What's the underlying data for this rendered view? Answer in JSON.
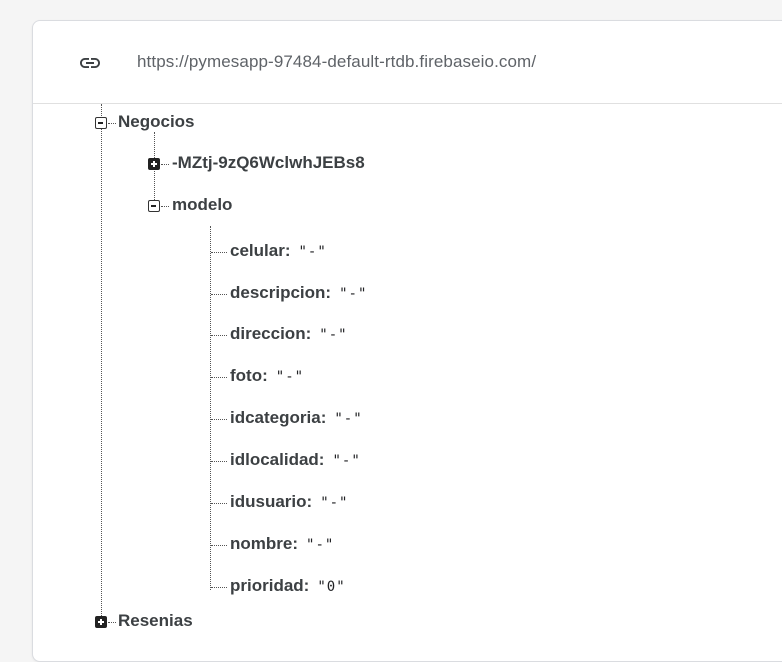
{
  "database": {
    "url": "https://pymesapp-97484-default-rtdb.firebaseio.com/",
    "link_icon": "link-icon"
  },
  "tree": {
    "negocios": {
      "label": "Negocios",
      "expanded": true,
      "child_id": {
        "label": "-MZtj-9zQ6WclwhJEBs8",
        "expanded": false
      },
      "modelo": {
        "label": "modelo",
        "expanded": true,
        "fields": [
          {
            "key": "celular",
            "value": "\"-\""
          },
          {
            "key": "descripcion",
            "value": "\"-\""
          },
          {
            "key": "direccion",
            "value": "\"-\""
          },
          {
            "key": "foto",
            "value": "\"-\""
          },
          {
            "key": "idcategoria",
            "value": "\"-\""
          },
          {
            "key": "idlocalidad",
            "value": "\"-\""
          },
          {
            "key": "idusuario",
            "value": "\"-\""
          },
          {
            "key": "nombre",
            "value": "\"-\""
          },
          {
            "key": "prioridad",
            "value": "\"0\""
          }
        ]
      }
    },
    "resenias": {
      "label": "Resenias",
      "expanded": false
    }
  },
  "colors": {
    "text": "#3c4043",
    "url": "#5f6368",
    "border": "#dadce0"
  }
}
